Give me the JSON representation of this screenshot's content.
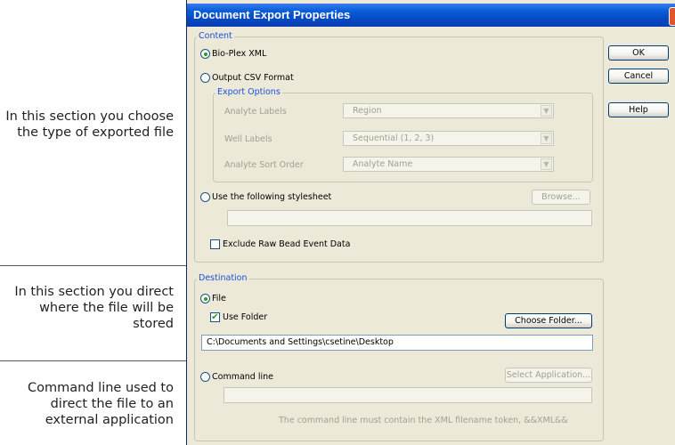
{
  "annotations": {
    "content_note": "In this section you choose the type of exported file",
    "destination_note": "In this section you direct where the file will be stored",
    "command_note": "Command line used to direct the file to an external application"
  },
  "dialog": {
    "title": "Document Export Properties",
    "close_glyph": "✕",
    "buttons": {
      "ok": "OK",
      "cancel": "Cancel",
      "help": "Help"
    }
  },
  "content": {
    "legend": "Content",
    "bioplex_label": "Bio-Plex XML",
    "bioplex_selected": true,
    "csv_label": "Output CSV Format",
    "csv_selected": false,
    "export_options": {
      "legend": "Export Options",
      "analyte_labels_label": "Analyte Labels",
      "analyte_labels_value": "Region",
      "well_labels_label": "Well Labels",
      "well_labels_value": "Sequential (1, 2, 3)",
      "sort_order_label": "Analyte Sort Order",
      "sort_order_value": "Analyte Name"
    },
    "stylesheet_label": "Use the following stylesheet",
    "browse_label": "Browse...",
    "stylesheet_path": "",
    "exclude_raw_label": "Exclude Raw Bead Event Data",
    "exclude_raw_checked": false
  },
  "destination": {
    "legend": "Destination",
    "file_label": "File",
    "file_selected": true,
    "use_folder_label": "Use Folder",
    "use_folder_checked": true,
    "choose_folder_label": "Choose Folder...",
    "path": "C:\\Documents and Settings\\csetine\\Desktop",
    "command_label": "Command line",
    "command_selected": false,
    "select_app_label": "Select Application...",
    "command_value": "",
    "command_hint": "The command line must contain the XML filename token, &&XML&&"
  },
  "colors": {
    "titlebar": "#0a5fd8",
    "dialog_bg": "#ece9d8",
    "legend_text": "#1c50d8",
    "radio_dot": "#21a121",
    "close_button": "#e0562a"
  },
  "icons": {
    "close": "close-icon",
    "combo_arrow": "chevron-down-icon",
    "check": "checkmark-icon"
  }
}
